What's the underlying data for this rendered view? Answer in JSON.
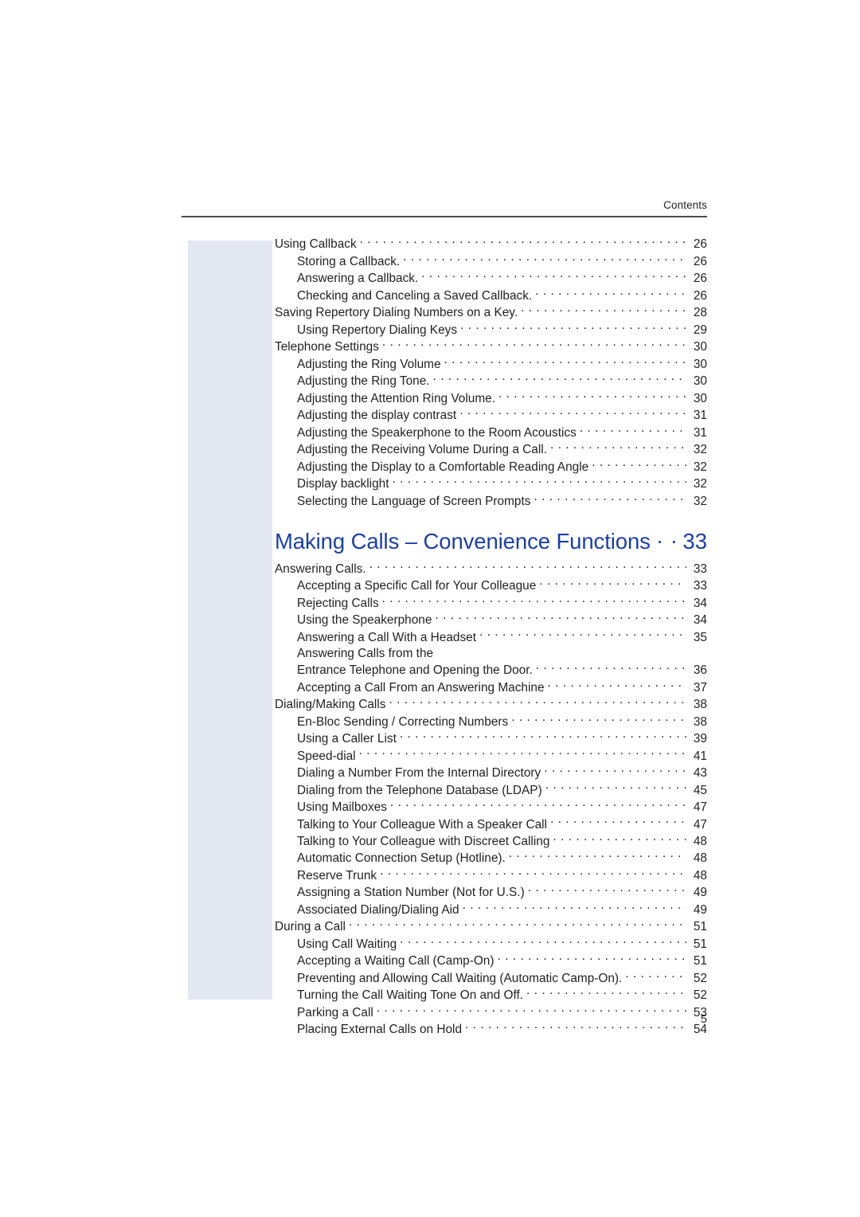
{
  "header": {
    "running_head": "Contents"
  },
  "folio": {
    "page_number": "5"
  },
  "colors": {
    "heading_blue": "#1b3fa8",
    "side_block": "#e3e7f2",
    "text": "#231f20",
    "rule": "#4b4b4d"
  },
  "toc": {
    "entries_before_chapter": [
      {
        "level": 1,
        "title": "Using Callback",
        "page": "26"
      },
      {
        "level": 2,
        "title": "Storing a Callback.",
        "page": "26"
      },
      {
        "level": 2,
        "title": "Answering a Callback.",
        "page": "26"
      },
      {
        "level": 2,
        "title": "Checking and Canceling a Saved Callback.",
        "page": "26"
      },
      {
        "level": 1,
        "title": "Saving Repertory Dialing Numbers on a Key.",
        "page": "28"
      },
      {
        "level": 2,
        "title": "Using Repertory Dialing Keys",
        "page": "29"
      },
      {
        "level": 1,
        "title": "Telephone Settings",
        "page": "30"
      },
      {
        "level": 2,
        "title": "Adjusting the Ring Volume",
        "page": "30"
      },
      {
        "level": 2,
        "title": "Adjusting the Ring Tone.",
        "page": "30"
      },
      {
        "level": 2,
        "title": "Adjusting the Attention Ring Volume.",
        "page": "30"
      },
      {
        "level": 2,
        "title": "Adjusting the display contrast",
        "page": "31"
      },
      {
        "level": 2,
        "title": "Adjusting the Speakerphone to the Room Acoustics",
        "page": "31"
      },
      {
        "level": 2,
        "title": "Adjusting the Receiving Volume During a Call.",
        "page": "32"
      },
      {
        "level": 2,
        "title": "Adjusting the Display to a Comfortable Reading Angle",
        "page": "32"
      },
      {
        "level": 2,
        "title": "Display backlight",
        "page": "32"
      },
      {
        "level": 2,
        "title": "Selecting the Language of Screen Prompts",
        "page": "32"
      }
    ],
    "chapter": {
      "title": "Making Calls – Convenience Functions",
      "page": "33"
    },
    "entries_after_chapter": [
      {
        "level": 1,
        "title": "Answering Calls.",
        "page": "33"
      },
      {
        "level": 2,
        "title": "Accepting a Specific Call for Your Colleague",
        "page": "33"
      },
      {
        "level": 2,
        "title": "Rejecting Calls",
        "page": "34"
      },
      {
        "level": 2,
        "title": "Using the Speakerphone",
        "page": "34"
      },
      {
        "level": 2,
        "title": "Answering a Call With a Headset",
        "page": "35"
      },
      {
        "level": 2,
        "title": "Answering Calls from the",
        "page": "",
        "no_leader": true
      },
      {
        "level": 2,
        "title": "Entrance Telephone and Opening the Door.",
        "page": "36"
      },
      {
        "level": 2,
        "title": "Accepting a Call From an Answering Machine",
        "page": "37"
      },
      {
        "level": 1,
        "title": "Dialing/Making Calls",
        "page": "38"
      },
      {
        "level": 2,
        "title": "En-Bloc Sending / Correcting Numbers",
        "page": "38"
      },
      {
        "level": 2,
        "title": "Using a Caller List",
        "page": "39"
      },
      {
        "level": 2,
        "title": "Speed-dial",
        "page": "41"
      },
      {
        "level": 2,
        "title": "Dialing a Number From the Internal Directory",
        "page": "43"
      },
      {
        "level": 2,
        "title": "Dialing from the Telephone Database (LDAP)",
        "page": "45"
      },
      {
        "level": 2,
        "title": "Using Mailboxes",
        "page": "47"
      },
      {
        "level": 2,
        "title": "Talking to Your Colleague With a Speaker Call",
        "page": "47"
      },
      {
        "level": 2,
        "title": "Talking to Your Colleague with Discreet Calling",
        "page": "48"
      },
      {
        "level": 2,
        "title": "Automatic Connection Setup (Hotline).",
        "page": "48"
      },
      {
        "level": 2,
        "title": "Reserve Trunk",
        "page": "48"
      },
      {
        "level": 2,
        "title": "Assigning a Station Number (Not for U.S.)",
        "page": "49"
      },
      {
        "level": 2,
        "title": "Associated Dialing/Dialing Aid",
        "page": "49"
      },
      {
        "level": 1,
        "title": "During a Call",
        "page": "51"
      },
      {
        "level": 2,
        "title": "Using Call Waiting",
        "page": "51"
      },
      {
        "level": 2,
        "title": "Accepting a Waiting Call (Camp-On)",
        "page": "51"
      },
      {
        "level": 2,
        "title": "Preventing and Allowing Call Waiting (Automatic Camp-On).",
        "page": "52"
      },
      {
        "level": 2,
        "title": "Turning the Call Waiting Tone On and Off.",
        "page": "52"
      },
      {
        "level": 2,
        "title": "Parking a Call",
        "page": "53"
      },
      {
        "level": 2,
        "title": "Placing External Calls on Hold",
        "page": "54"
      }
    ]
  }
}
